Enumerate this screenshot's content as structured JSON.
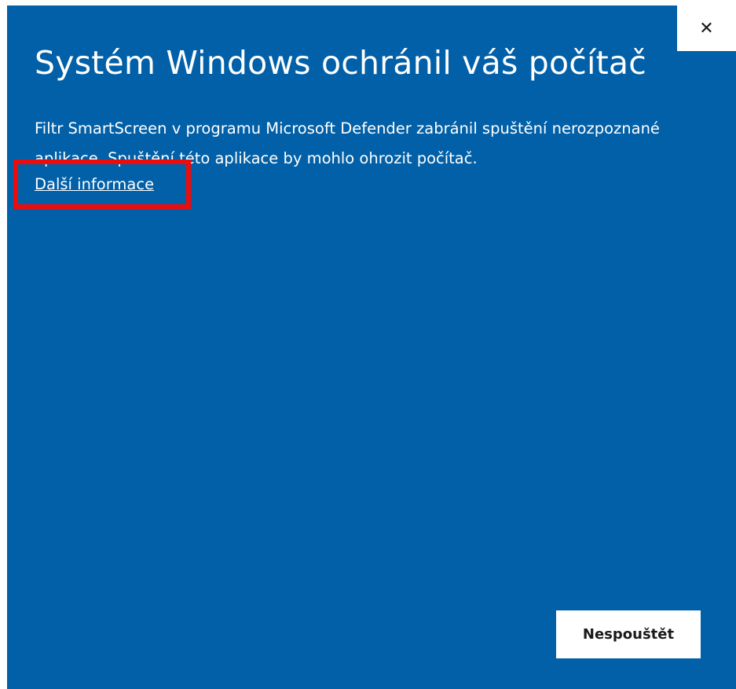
{
  "dialog": {
    "title": "Systém Windows ochránil váš počítač",
    "message": "Filtr SmartScreen v programu Microsoft Defender zabránil spuštění nerozpoznané aplikace. Spuštění této aplikace by mohlo ohrozit počítač.",
    "more_info_link": "Další informace",
    "close_glyph": "✕",
    "dont_run_button": "Nespouštět",
    "close_icon": "close-icon"
  },
  "colors": {
    "background": "#0160a8",
    "text": "#ffffff",
    "highlight": "#ec0c0c",
    "button": "#ffffff"
  }
}
